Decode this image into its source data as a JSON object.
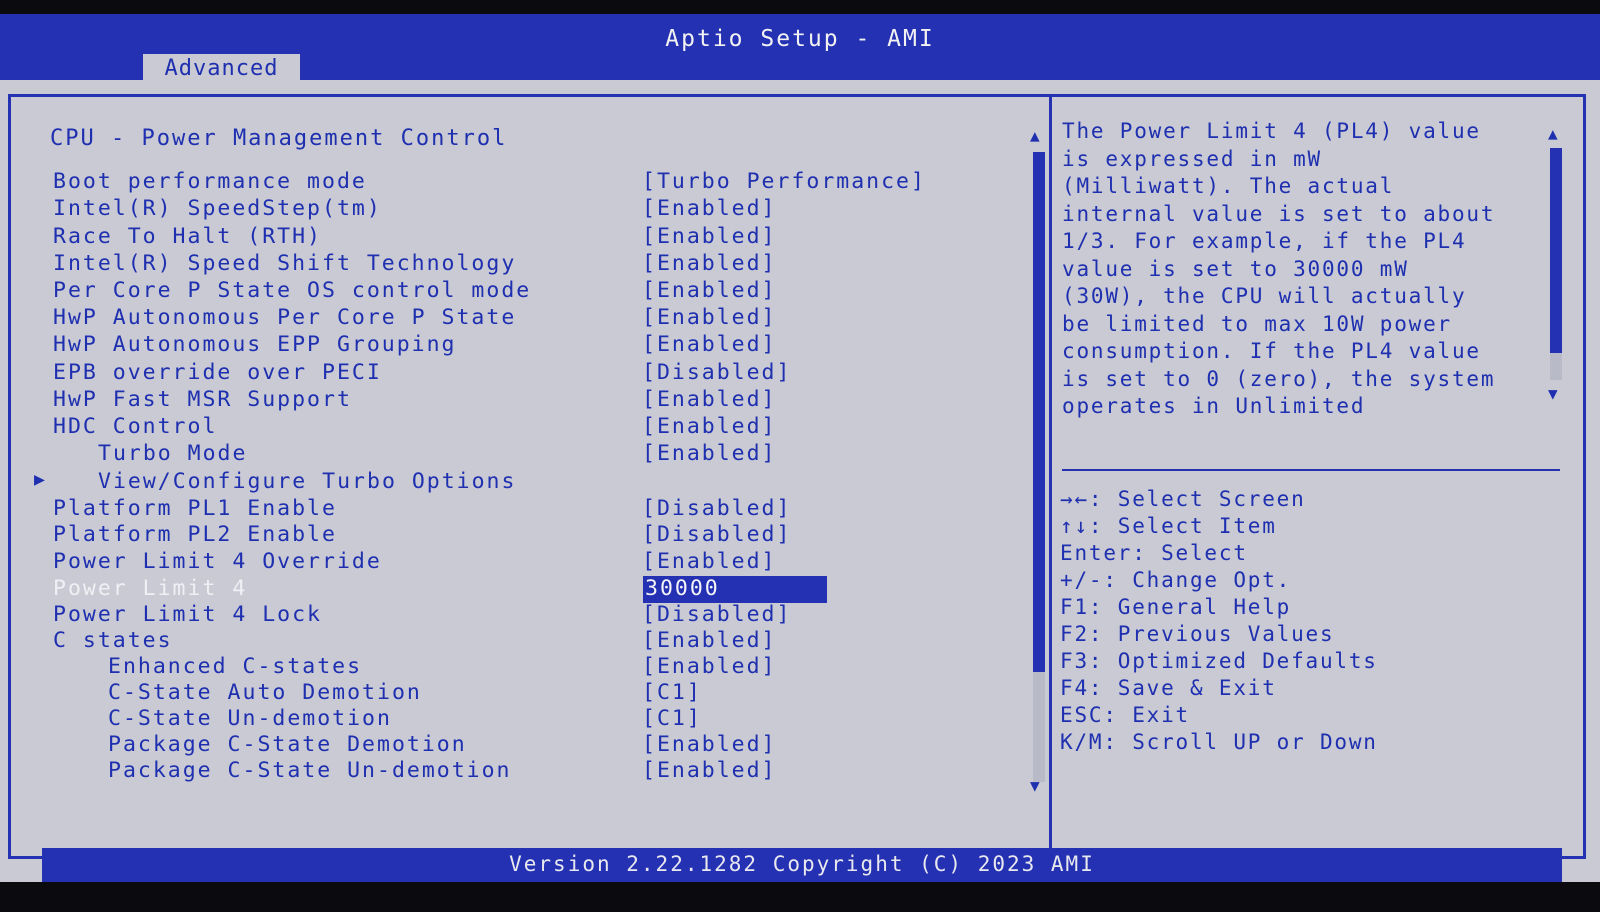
{
  "app_title": "Aptio Setup - AMI",
  "tab": "Advanced",
  "panel_title": "CPU - Power Management Control",
  "items": [
    {
      "label": "Boot performance mode",
      "value": "[Turbo Performance]"
    },
    {
      "label": "Intel(R) SpeedStep(tm)",
      "value": "[Enabled]"
    },
    {
      "label": "Race To Halt (RTH)",
      "value": "[Enabled]"
    },
    {
      "label": "Intel(R) Speed Shift Technology",
      "value": "[Enabled]"
    },
    {
      "label": "Per Core P State OS control mode",
      "value": "[Enabled]"
    },
    {
      "label": "HwP Autonomous Per Core P State",
      "value": "[Enabled]"
    },
    {
      "label": "HwP Autonomous EPP Grouping",
      "value": "[Enabled]"
    },
    {
      "label": "EPB override over PECI",
      "value": "[Disabled]"
    },
    {
      "label": "HwP Fast MSR Support",
      "value": "[Enabled]"
    },
    {
      "label": "HDC Control",
      "value": "[Enabled]"
    },
    {
      "label": "Turbo Mode",
      "value": "[Enabled]"
    },
    {
      "label": "View/Configure Turbo Options",
      "value": ""
    },
    {
      "label": "Platform PL1 Enable",
      "value": "[Disabled]"
    },
    {
      "label": "Platform PL2 Enable",
      "value": "[Disabled]"
    },
    {
      "label": "Power Limit 4 Override",
      "value": "[Enabled]"
    },
    {
      "label": "Power Limit 4",
      "value": "30000"
    },
    {
      "label": "Power Limit 4 Lock",
      "value": "[Disabled]"
    },
    {
      "label": "C states",
      "value": "[Enabled]"
    },
    {
      "label": "Enhanced C-states",
      "value": "[Enabled]"
    },
    {
      "label": "C-State Auto Demotion",
      "value": "[C1]"
    },
    {
      "label": "C-State Un-demotion",
      "value": "[C1]"
    },
    {
      "label": "Package C-State Demotion",
      "value": "[Enabled]"
    },
    {
      "label": "Package C-State Un-demotion",
      "value": "[Enabled]"
    }
  ],
  "help": [
    "The Power Limit 4 (PL4) value",
    "is expressed in mW",
    "(Milliwatt). The actual",
    "internal value is set to about",
    "1/3. For example, if the PL4",
    "value is set to 30000 mW",
    "(30W), the CPU will actually",
    "be limited to max 10W power",
    "consumption. If the PL4 value",
    "is set to 0 (zero), the system",
    "operates in Unlimited"
  ],
  "keys": [
    "→←: Select Screen",
    "↑↓: Select Item",
    "Enter: Select",
    "+/-: Change Opt.",
    "F1: General Help",
    "F2: Previous Values",
    "F3: Optimized Defaults",
    "F4: Save & Exit",
    "ESC: Exit",
    "K/M: Scroll UP or Down"
  ],
  "footer": "Version 2.22.1282 Copyright (C) 2023 AMI",
  "submenu_arrow": "▶",
  "scroll_up": "▲",
  "scroll_down": "▼",
  "selected_index": 15,
  "colors": {
    "accent": "#2431b3",
    "background": "#c9cad3",
    "text": "#1e2fb0"
  }
}
